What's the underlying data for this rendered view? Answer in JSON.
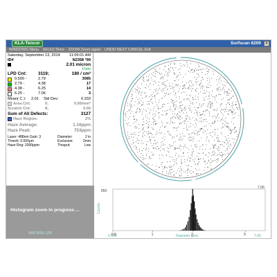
{
  "window": {
    "title": "KLA-Tencor",
    "brand": "Surfscan 6200",
    "close_glyph": "x"
  },
  "menu": {
    "items": [
      "WINDOWS Menu",
      "SELECTions",
      "ZOOM  Zoom again",
      "UNDO  NEXT  CANCEL  Exit"
    ]
  },
  "info": {
    "date": "Saturday, September 13, 2014",
    "time": "11:05:01 AM",
    "id_label": "ID#",
    "id_value": "N2358 *99",
    "threshold": "2.01 micron",
    "status": "Flats",
    "lpd_label": "LPD Cnt:",
    "lpd_count": "3119;",
    "lpd_density": "180 / cm²",
    "bins": [
      {
        "lo": "0.500 -",
        "hi": "2.79",
        "count": "3085",
        "color": "#f0f000"
      },
      {
        "lo": "2.79 -",
        "hi": "4.38",
        "count": "17",
        "color": "#00c000"
      },
      {
        "lo": "4.38 -",
        "hi": "6.25",
        "count": "14",
        "color": "#f08080"
      },
      {
        "lo": "6.25 -",
        "hi": "7.06",
        "count": "3",
        "color": "#ffffff"
      }
    ],
    "mean_label": "Mean(  C ):",
    "mean_value": "2.01",
    "std_label": "Std Dev:",
    "std_value": "0.333",
    "area_label": "Area Cnt:",
    "area_num": "0;",
    "area_value": "0.00/mm²",
    "scratch_label": "Scratch Cnt:",
    "scratch_num": "8;",
    "scratch_value": "0.00",
    "sum_label": "Sum of All Defects:",
    "sum_value": "3127",
    "haze_region_label": "Haze Region:",
    "haze_region_value": "2%",
    "haze_avg_label": "Haze Average:",
    "haze_avg_value": "1.16ppm",
    "haze_peak_label": "Haze Peak:",
    "haze_peak_value": "753ppm",
    "laser": "Laser: 488nm Gain: 3",
    "diameter_label": "Diameter:",
    "diameter_value": "2 in",
    "thresh": "Thresh:     0.500µm",
    "exclusion_label": "Exclusion:",
    "exclusion_value": "2mm",
    "haze_rng": "Haze Rng:  2000ppm",
    "thruput_label": "Thruput:",
    "thruput_value": "Low"
  },
  "status": {
    "message": "Histogram zoom in progress ...",
    "serial": "S/N   0691-120"
  },
  "chart_data": {
    "type": "bar",
    "x_label": "Diameter (µm)",
    "y_label": "Counts",
    "x_min_label": "0.500",
    "x_max_label": "7.06",
    "y_max_label": "850",
    "top_right_label": "7.06",
    "x_ticks": [
      "0.5",
      "1",
      "2",
      "5"
    ],
    "xlim": [
      0.5,
      7.06
    ],
    "log_x": true,
    "ylim": [
      0,
      850
    ],
    "peak_x": 2.01,
    "bars": [
      [
        1.6,
        5
      ],
      [
        1.64,
        12
      ],
      [
        1.68,
        25
      ],
      [
        1.72,
        40
      ],
      [
        1.76,
        70
      ],
      [
        1.8,
        120
      ],
      [
        1.84,
        190
      ],
      [
        1.88,
        280
      ],
      [
        1.92,
        420
      ],
      [
        1.95,
        560
      ],
      [
        1.98,
        700
      ],
      [
        2.0,
        850
      ],
      [
        2.03,
        720
      ],
      [
        2.06,
        600
      ],
      [
        2.09,
        450
      ],
      [
        2.12,
        330
      ],
      [
        2.16,
        230
      ],
      [
        2.2,
        160
      ],
      [
        2.24,
        110
      ],
      [
        2.28,
        75
      ],
      [
        2.32,
        50
      ],
      [
        2.36,
        30
      ],
      [
        2.4,
        18
      ],
      [
        2.45,
        10
      ],
      [
        2.5,
        5
      ]
    ]
  }
}
